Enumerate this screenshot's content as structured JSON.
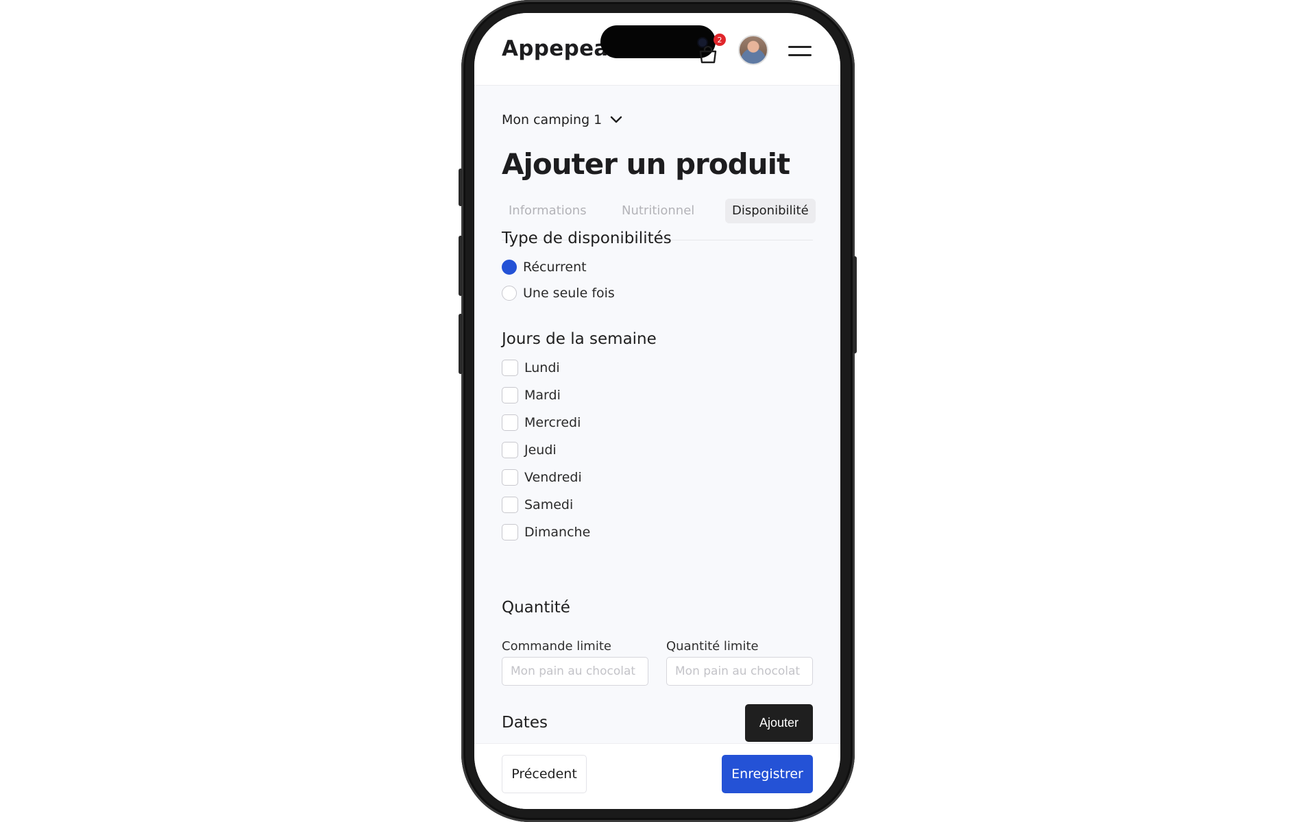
{
  "header": {
    "logo": "Appepea",
    "cart_count": "2"
  },
  "camp_selector": {
    "label": "Mon camping 1"
  },
  "page_title": "Ajouter un produit",
  "tabs": [
    {
      "label": "Informations",
      "active": false
    },
    {
      "label": "Nutritionnel",
      "active": false
    },
    {
      "label": "Disponibilité",
      "active": true
    }
  ],
  "availability": {
    "heading": "Type de disponibilités",
    "options": [
      {
        "label": "Récurrent",
        "selected": true
      },
      {
        "label": "Une seule fois",
        "selected": false
      }
    ]
  },
  "weekdays": {
    "heading": "Jours de la semaine",
    "days": [
      {
        "label": "Lundi",
        "checked": false
      },
      {
        "label": "Mardi",
        "checked": false
      },
      {
        "label": "Mercredi",
        "checked": false
      },
      {
        "label": "Jeudi",
        "checked": false
      },
      {
        "label": "Vendredi",
        "checked": false
      },
      {
        "label": "Samedi",
        "checked": false
      },
      {
        "label": "Dimanche",
        "checked": false
      }
    ]
  },
  "quantity": {
    "heading": "Quantité",
    "order_limit": {
      "label": "Commande limite",
      "placeholder": "Mon pain au chocolat",
      "value": ""
    },
    "quantity_limit": {
      "label": "Quantité limite",
      "placeholder": "Mon pain au chocolat",
      "value": ""
    }
  },
  "dates": {
    "heading": "Dates",
    "add_button": "Ajouter"
  },
  "footer": {
    "prev_button": "Précedent",
    "save_button": "Enregistrer"
  },
  "colors": {
    "accent": "#2452d6",
    "dark_button": "#1f1f1f",
    "badge": "#e0262b"
  }
}
